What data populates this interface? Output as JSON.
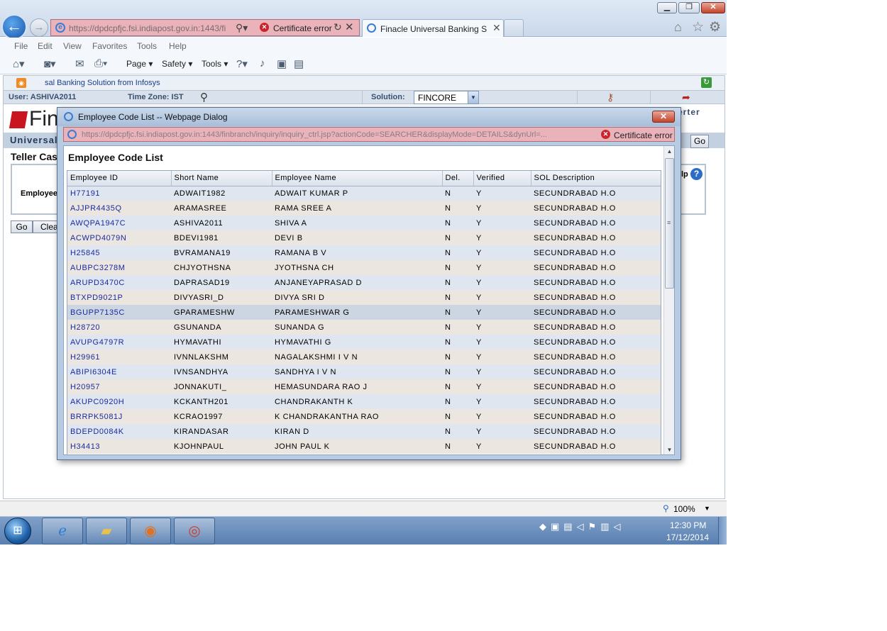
{
  "browser": {
    "address_url": "https://dpdcpfjc.fsi.indiapost.gov.in:1443/fi",
    "certificate_error": "Certificate error",
    "tab_title": "Finacle Universal Banking S...",
    "menu": [
      "File",
      "Edit",
      "View",
      "Favorites",
      "Tools",
      "Help"
    ],
    "commands": {
      "page": "Page",
      "safety": "Safety",
      "tools": "Tools"
    },
    "zoom": "100%"
  },
  "page": {
    "strip_title": "sal Banking Solution from Infosys",
    "user_label": "User: ASHIVA2011",
    "timezone_label": "Time Zone:  IST",
    "solution_label": "Solution:",
    "solution_value": "FINCORE",
    "logo_text": "Fin",
    "universal_label": "Universal",
    "teller_title": "Teller Cas",
    "employee_label": "Employee",
    "go_label": "Go",
    "clear_label": "Clea",
    "right_go_label": "Go",
    "right_label": "erter",
    "help_label": "lp"
  },
  "dialog": {
    "title": "Employee Code List -- Webpage Dialog",
    "url": "https://dpdcpfjc.fsi.indiapost.gov.in:1443/finbranch/inquiry/inquiry_ctrl.jsp?actionCode=SEARCHER&displayMode=DETAILS&dynUrl=...",
    "certificate_error": "Certificate error",
    "heading": "Employee Code List",
    "columns": [
      "Employee ID",
      "Short Name",
      "Employee Name",
      "Del.",
      "Verified",
      "SOL Description"
    ],
    "rows": [
      [
        "H77191",
        "ADWAIT1982",
        "ADWAIT KUMAR P",
        "N",
        "Y",
        "SECUNDRABAD H.O"
      ],
      [
        "AJJPR4435Q",
        "ARAMASREE",
        "RAMA SREE A",
        "N",
        "Y",
        "SECUNDRABAD H.O"
      ],
      [
        "AWQPA1947C",
        "ASHIVA2011",
        "SHIVA A",
        "N",
        "Y",
        "SECUNDRABAD H.O"
      ],
      [
        "ACWPD4079N",
        "BDEVI1981",
        "DEVI B",
        "N",
        "Y",
        "SECUNDRABAD H.O"
      ],
      [
        "H25845",
        "BVRAMANA19",
        "RAMANA B V",
        "N",
        "Y",
        "SECUNDRABAD H.O"
      ],
      [
        "AUBPC3278M",
        "CHJYOTHSNA",
        "JYOTHSNA CH",
        "N",
        "Y",
        "SECUNDRABAD H.O"
      ],
      [
        "ARUPD3470C",
        "DAPRASAD19",
        "ANJANEYAPRASAD D",
        "N",
        "Y",
        "SECUNDRABAD H.O"
      ],
      [
        "BTXPD9021P",
        "DIVYASRI_D",
        "DIVYA SRI D",
        "N",
        "Y",
        "SECUNDRABAD H.O"
      ],
      [
        "BGUPP7135C",
        "GPARAMESHW",
        "PARAMESHWAR G",
        "N",
        "Y",
        "SECUNDRABAD H.O"
      ],
      [
        "H28720",
        "GSUNANDA",
        "SUNANDA G",
        "N",
        "Y",
        "SECUNDRABAD H.O"
      ],
      [
        "AVUPG4797R",
        "HYMAVATHI",
        "HYMAVATHI G",
        "N",
        "Y",
        "SECUNDRABAD H.O"
      ],
      [
        "H29961",
        "IVNNLAKSHM",
        "NAGALAKSHMI I V N",
        "N",
        "Y",
        "SECUNDRABAD H.O"
      ],
      [
        "ABIPI6304E",
        "IVNSANDHYA",
        "SANDHYA I V N",
        "N",
        "Y",
        "SECUNDRABAD H.O"
      ],
      [
        "H20957",
        "JONNAKUTI_",
        "HEMASUNDARA RAO J",
        "N",
        "Y",
        "SECUNDRABAD H.O"
      ],
      [
        "AKUPC0920H",
        "KCKANTH201",
        "CHANDRAKANTH K",
        "N",
        "Y",
        "SECUNDRABAD H.O"
      ],
      [
        "BRRPK5081J",
        "KCRAO1997",
        "K CHANDRAKANTHA RAO",
        "N",
        "Y",
        "SECUNDRABAD H.O"
      ],
      [
        "BDEPD0084K",
        "KIRANDASAR",
        "KIRAN D",
        "N",
        "Y",
        "SECUNDRABAD H.O"
      ],
      [
        "H34413",
        "KJOHNPAUL",
        "JOHN PAUL K",
        "N",
        "Y",
        "SECUNDRABAD H.O"
      ]
    ]
  },
  "taskbar": {
    "time": "12:30 PM",
    "date": "17/12/2014"
  }
}
